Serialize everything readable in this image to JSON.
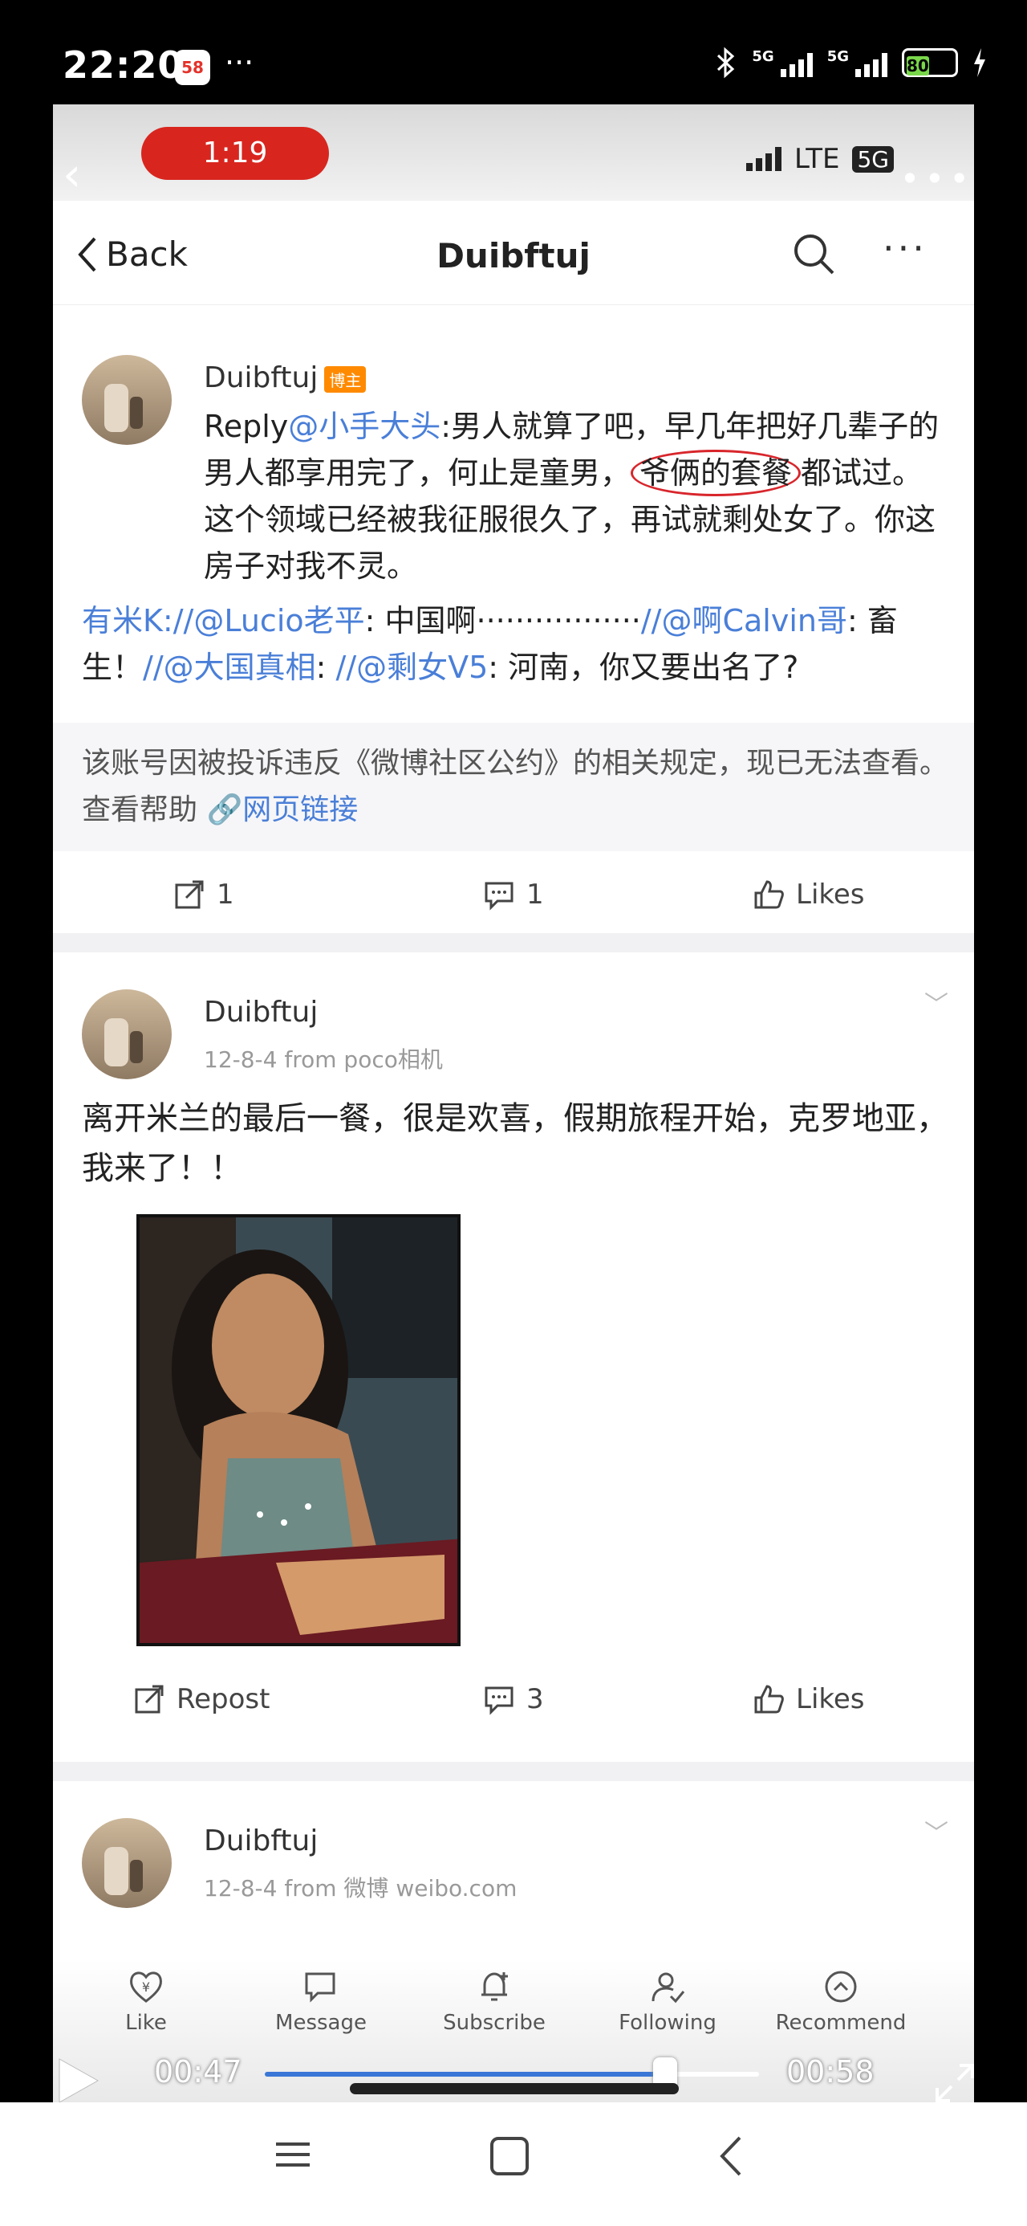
{
  "status_bar": {
    "time": "22:20",
    "app_badge": "58",
    "dots": "···",
    "network1": "5G",
    "network2": "5G",
    "battery": "80"
  },
  "inner_status": {
    "recording_timer": "1:19",
    "network": "LTE",
    "network_badge": "5G"
  },
  "nav": {
    "back_label": "Back",
    "title": "Duibftuj"
  },
  "post1": {
    "username": "Duibftuj",
    "badge": "博主",
    "reply_prefix": "Reply",
    "mention": "@小手大头",
    "text_before_circle": ":男人就算了吧，早几年把好几辈子的男人都享用完了，何止是童男，",
    "circled_text": "爷俩的套餐",
    "text_after_circle": "都试过。这个领域已经被我征服很久了，再试就剩处女了。你这房子对我不灵。",
    "repost_chain": {
      "u1": "有米K:",
      "m1": "//@Lucio老平",
      "t1": ": 中国啊·················",
      "m2": "//@啊Calvin哥",
      "t2": ": 畜生！",
      "m3": "//@大国真相",
      "t3": ": ",
      "m4": "//@剩女V5",
      "t4": ": 河南，你又要出名了?"
    },
    "notice": "该账号因被投诉违反《微博社区公约》的相关规定，现已无法查看。查看帮助",
    "notice_link": "网页链接",
    "repost_count": "1",
    "comment_count": "1",
    "likes_label": "Likes"
  },
  "post2": {
    "username": "Duibftuj",
    "meta": "12-8-4  from poco相机",
    "text": "离开米兰的最后一餐，很是欢喜，假期旅程开始，克罗地亚，我来了！！",
    "repost_label": "Repost",
    "comment_count": "3",
    "likes_label": "Likes"
  },
  "post3": {
    "username": "Duibftuj",
    "meta": "12-8-4  from 微博 weibo.com"
  },
  "player": {
    "tabs": [
      {
        "label": "Like",
        "icon": "yen-heart-icon"
      },
      {
        "label": "Message",
        "icon": "chat-icon"
      },
      {
        "label": "Subscribe",
        "icon": "bell-plus-icon"
      },
      {
        "label": "Following",
        "icon": "person-check-icon"
      },
      {
        "label": "Recommend",
        "icon": "up-circle-icon"
      }
    ],
    "current_time": "00:47",
    "total_time": "00:58",
    "progress": 0.81
  }
}
